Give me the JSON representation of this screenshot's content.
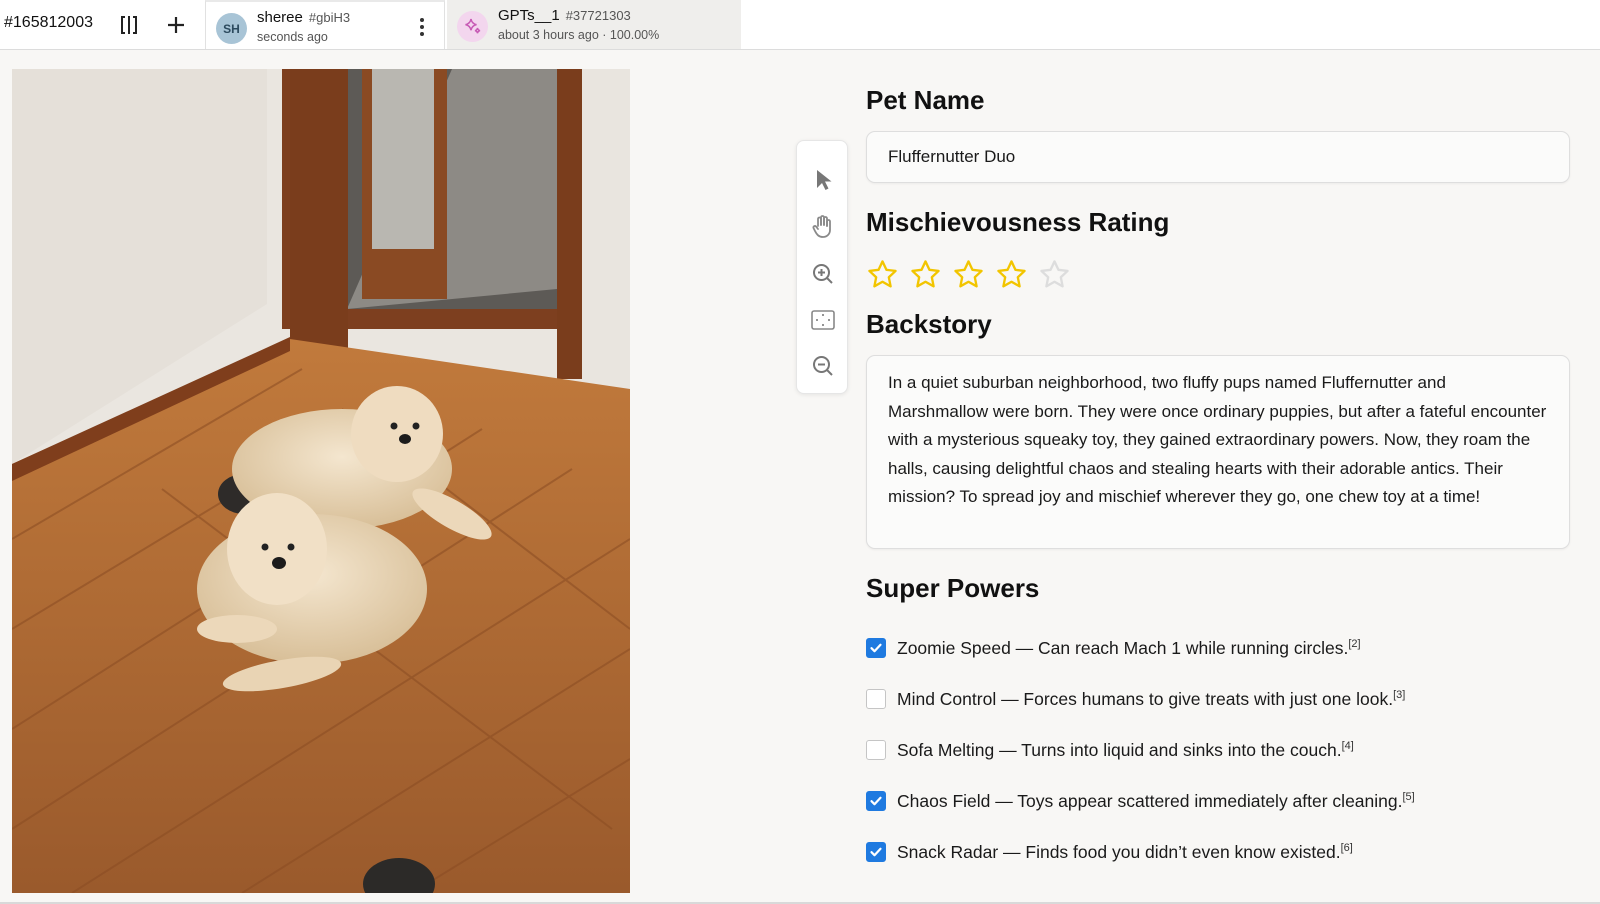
{
  "header": {
    "task_id": "#165812003",
    "tabs": [
      {
        "avatar": "SH",
        "name": "sheree",
        "hash": "#gbiH3",
        "subtitle": "seconds ago",
        "active": true
      },
      {
        "avatar": "",
        "name": "GPTs__1",
        "hash": "#37721303",
        "subtitle": "about 3 hours ago · 100.00%",
        "active": false
      }
    ],
    "icons": [
      "split-view-icon",
      "plus-icon",
      "more-vertical-icon",
      "sparkle-icon"
    ]
  },
  "image": {
    "description_icon": "photo-two-puppies"
  },
  "toolbar": {
    "tools": [
      "cursor-icon",
      "hand-icon",
      "zoom-in-icon",
      "fit-screen-icon",
      "zoom-out-icon"
    ]
  },
  "form": {
    "pet_name_label": "Pet Name",
    "pet_name_value": "Fluffernutter Duo",
    "rating_label": "Mischievousness Rating",
    "rating": {
      "value": 4,
      "max": 5,
      "color_filled": "#f2c500",
      "color_empty": "#dddddd"
    },
    "backstory_label": "Backstory",
    "backstory_value": "In a quiet suburban neighborhood, two fluffy pups named Fluffernutter and Marshmallow were born. They were once ordinary puppies, but after a fateful encounter with a mysterious squeaky toy, they gained extraordinary powers. Now, they roam the halls, causing delightful chaos and stealing hearts with their adorable antics. Their mission? To spread joy and mischief wherever they go, one chew toy at a time!",
    "superpowers_label": "Super Powers",
    "superpowers": [
      {
        "text": "Zoomie Speed — Can reach Mach 1 while running circles.",
        "ref": "[2]",
        "checked": true
      },
      {
        "text": "Mind Control — Forces humans to give treats with just one look.",
        "ref": "[3]",
        "checked": false
      },
      {
        "text": "Sofa Melting — Turns into liquid and sinks into the couch.",
        "ref": "[4]",
        "checked": false
      },
      {
        "text": "Chaos Field — Toys appear scattered immediately after cleaning.",
        "ref": "[5]",
        "checked": true
      },
      {
        "text": "Snack Radar — Finds food you didn’t even know existed.",
        "ref": "[6]",
        "checked": true
      }
    ]
  },
  "colors": {
    "accent": "#1f7ae0",
    "star": "#f2c500",
    "background": "#f8f7f5"
  }
}
